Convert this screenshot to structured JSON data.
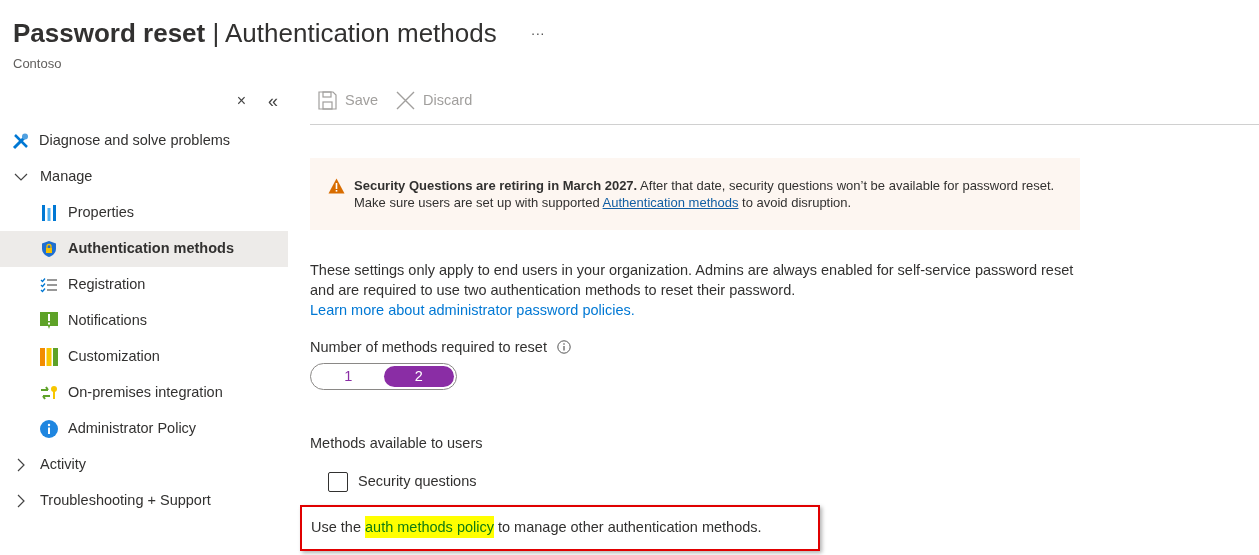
{
  "header": {
    "title_bold": "Password reset",
    "title_rest": "| Authentication methods",
    "more": "···",
    "subtitle": "Contoso"
  },
  "sidebar": {
    "close": "×",
    "collapse": "«",
    "items": [
      {
        "label": "Diagnose and solve problems",
        "kind": "link",
        "selected": false
      },
      {
        "label": "Manage",
        "kind": "group",
        "expanded": true,
        "children": [
          {
            "label": "Properties",
            "selected": false
          },
          {
            "label": "Authentication methods",
            "selected": true
          },
          {
            "label": "Registration",
            "selected": false
          },
          {
            "label": "Notifications",
            "selected": false
          },
          {
            "label": "Customization",
            "selected": false
          },
          {
            "label": "On-premises integration",
            "selected": false
          },
          {
            "label": "Administrator Policy",
            "selected": false
          }
        ]
      },
      {
        "label": "Activity",
        "kind": "group",
        "expanded": false
      },
      {
        "label": "Troubleshooting + Support",
        "kind": "group",
        "expanded": false
      }
    ]
  },
  "toolbar": [
    {
      "label": "Save",
      "disabled": true
    },
    {
      "label": "Discard",
      "disabled": true
    }
  ],
  "banner": {
    "text": "**Security Questions are retiring in March 2027.** After that date, security questions won’t be available for password reset. Make sure users are set up with supported ",
    "link": "Authentication methods",
    "text_after": " to avoid disruption."
  },
  "intro": {
    "text": "These settings only apply to end users in your organization. Admins are always enabled for self-service password reset and are required to use two authentication methods to reset their password. ",
    "link": "Learn more about administrator password policies."
  },
  "methods_required": {
    "label": "Number of methods required to reset",
    "options": [
      {
        "label": "1",
        "selected": false
      },
      {
        "label": "2",
        "selected": true
      }
    ]
  },
  "methods_available": {
    "label": "Methods available to users",
    "options": [
      {
        "label": "Security questions",
        "checked": false
      }
    ]
  },
  "policy_note": {
    "text": "Use the ",
    "link": "auth methods policy",
    "text_after": " to manage other authentication methods.",
    "highlighted": true
  }
}
